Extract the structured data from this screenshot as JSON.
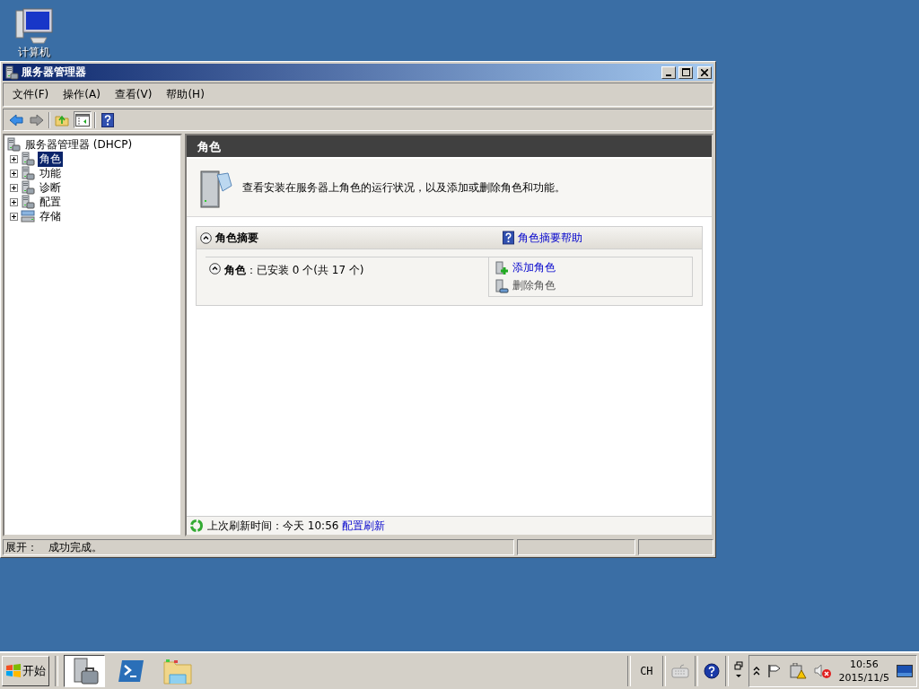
{
  "desktop_icons": [
    {
      "label": "计算机"
    }
  ],
  "window": {
    "title": "服务器管理器"
  },
  "menu": [
    "文件(F)",
    "操作(A)",
    "查看(V)",
    "帮助(H)"
  ],
  "toolbar": {
    "tree_toggle_pressed": true
  },
  "tree": {
    "label": "服务器管理器 (DHCP)",
    "children": [
      {
        "label": "角色",
        "kind": "roles",
        "selected": true,
        "expanded": false
      },
      {
        "label": "功能",
        "kind": "features",
        "selected": false,
        "expanded": false
      },
      {
        "label": "诊断",
        "kind": "diagnostics",
        "selected": false,
        "expanded": false
      },
      {
        "label": "配置",
        "kind": "configuration",
        "selected": false,
        "expanded": false
      },
      {
        "label": "存储",
        "kind": "storage",
        "selected": false,
        "expanded": false
      }
    ]
  },
  "content": {
    "header": "角色",
    "description": "查看安装在服务器上角色的运行状况，以及添加或删除角色和功能。",
    "summary": {
      "title": "角色摘要",
      "help_link": "角色摘要帮助",
      "roles_line": "**角色**：已安装 0 个(共 17 个)",
      "actions": [
        {
          "label": "添加角色",
          "kind": "add",
          "disabled": false
        },
        {
          "label": "删除角色",
          "kind": "remove",
          "disabled": true
        }
      ]
    },
    "refresh": {
      "text": "上次刷新时间：今天 10:56",
      "link": "配置刷新"
    }
  },
  "status_bar": {
    "text": "展开：　成功完成。"
  },
  "taskbar": {
    "start": "开始",
    "quick_launch": [
      {
        "kind": "server-manager",
        "active": true
      },
      {
        "kind": "powershell",
        "active": false
      },
      {
        "kind": "explorer",
        "active": false
      }
    ],
    "language": "CH",
    "time": "10:56",
    "date": "2015/11/5"
  }
}
